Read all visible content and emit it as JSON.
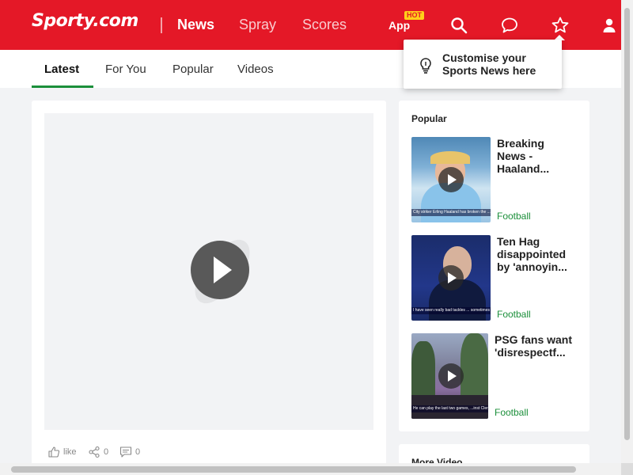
{
  "header": {
    "logo": "Sporty.com",
    "nav": [
      "News",
      "Spray",
      "Scores"
    ],
    "app_label": "App",
    "hot_badge": "HOT",
    "icons": [
      "search-icon",
      "chat-icon",
      "star-icon",
      "user-icon"
    ]
  },
  "tabs": [
    "Latest",
    "For You",
    "Popular",
    "Videos"
  ],
  "popover": {
    "text_line1": "Customise your",
    "text_line2": "Sports News here"
  },
  "main": {
    "actions": {
      "like": "like",
      "shares": "0",
      "comments": "0"
    }
  },
  "popular": {
    "title": "Popular",
    "items": [
      {
        "title": "Breaking News - Haaland...",
        "category": "Football",
        "caption": "City striker Erling Haaland has broken the ...ue record for most goals in a single season"
      },
      {
        "title": "Ten Hag disappointed by 'annoyin...",
        "category": "Football",
        "caption": "I have seen really bad tackles ... sometimes without whistles a..."
      },
      {
        "title": "PSG fans want 'disrespectf...",
        "category": "Football",
        "caption": "He can play the last two games, ...inst Clermont at the Parc des Princes"
      }
    ]
  },
  "more": {
    "title": "More Video"
  },
  "colors": {
    "brand": "#e41827",
    "accent": "#1b8f3a"
  }
}
